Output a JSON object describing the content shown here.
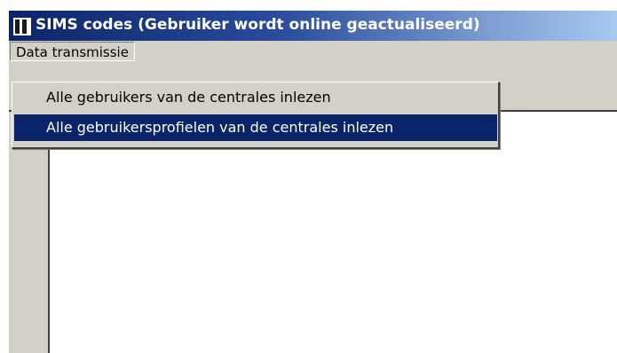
{
  "window": {
    "title": "SIMS codes (Gebruiker wordt online geactualiseerd)"
  },
  "menubar": {
    "items": [
      {
        "label": "Data transmissie"
      }
    ]
  },
  "dropdown": {
    "items": [
      {
        "label": "Alle gebruikers van de centrales inlezen",
        "selected": false
      },
      {
        "label": "Alle gebruikersprofielen van de centrales inlezen",
        "selected": true
      }
    ]
  },
  "colors": {
    "titlebar_start": "#0a246a",
    "titlebar_end": "#a6caf0",
    "selection": "#0a246a",
    "window_face": "#d4d0c8"
  },
  "icons": {
    "app": "app-icon"
  }
}
